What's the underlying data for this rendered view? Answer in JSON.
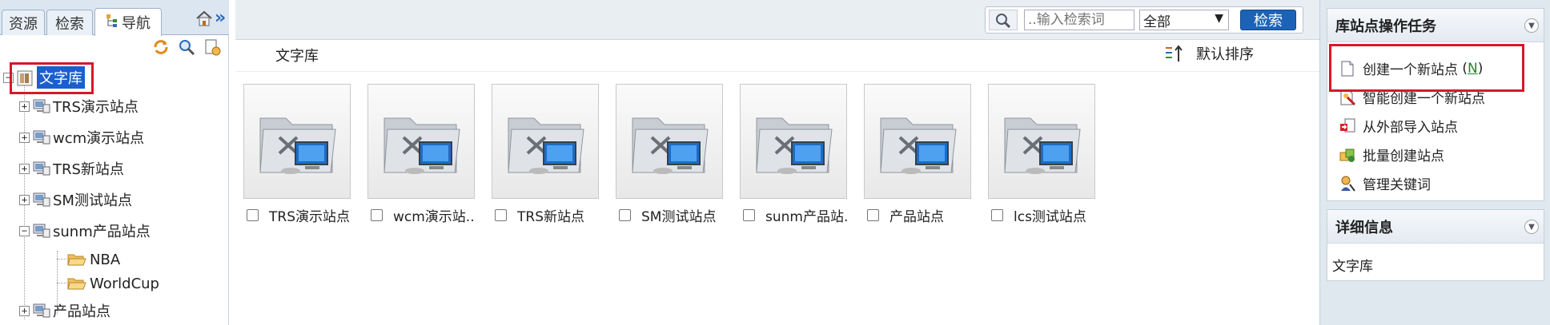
{
  "left_panel": {
    "tabs": [
      {
        "label": "资源",
        "active": false
      },
      {
        "label": "检索",
        "active": false
      },
      {
        "label": "导航",
        "active": true
      }
    ],
    "tree": {
      "root": "文字库",
      "sites": [
        {
          "label": "TRS演示站点",
          "expanded": false
        },
        {
          "label": "wcm演示站点",
          "expanded": false
        },
        {
          "label": "TRS新站点",
          "expanded": false
        },
        {
          "label": "SM测试站点",
          "expanded": false
        },
        {
          "label": "sunm产品站点",
          "expanded": true,
          "children": [
            "NBA",
            "WorldCup"
          ]
        },
        {
          "label": "产品站点",
          "expanded": false
        }
      ]
    }
  },
  "search": {
    "placeholder": "..输入检索词",
    "scope": "全部",
    "button": "检索"
  },
  "breadcrumb": "文字库",
  "sort_label": "默认排序",
  "sites_grid": [
    {
      "label": "TRS演示站点"
    },
    {
      "label": "wcm演示站.."
    },
    {
      "label": "TRS新站点"
    },
    {
      "label": "SM测试站点"
    },
    {
      "label": "sunm产品站."
    },
    {
      "label": "产品站点"
    },
    {
      "label": "lcs测试站点"
    }
  ],
  "right_panel": {
    "tasks_title": "库站点操作任务",
    "tasks": [
      {
        "label": "创建一个新站点",
        "shortcut": "N",
        "icon": "new-page-icon"
      },
      {
        "label": "智能创建一个新站点",
        "icon": "smart-create-icon"
      },
      {
        "label": "从外部导入站点",
        "icon": "import-icon"
      },
      {
        "label": "批量创建站点",
        "icon": "batch-create-icon"
      },
      {
        "label": "管理关键词",
        "icon": "keyword-icon"
      }
    ],
    "details_title": "详细信息",
    "details_text": "文字库"
  },
  "colors": {
    "selection": "#1a5fd0",
    "highlight_box": "#d6182a",
    "button": "#1c63b8"
  }
}
